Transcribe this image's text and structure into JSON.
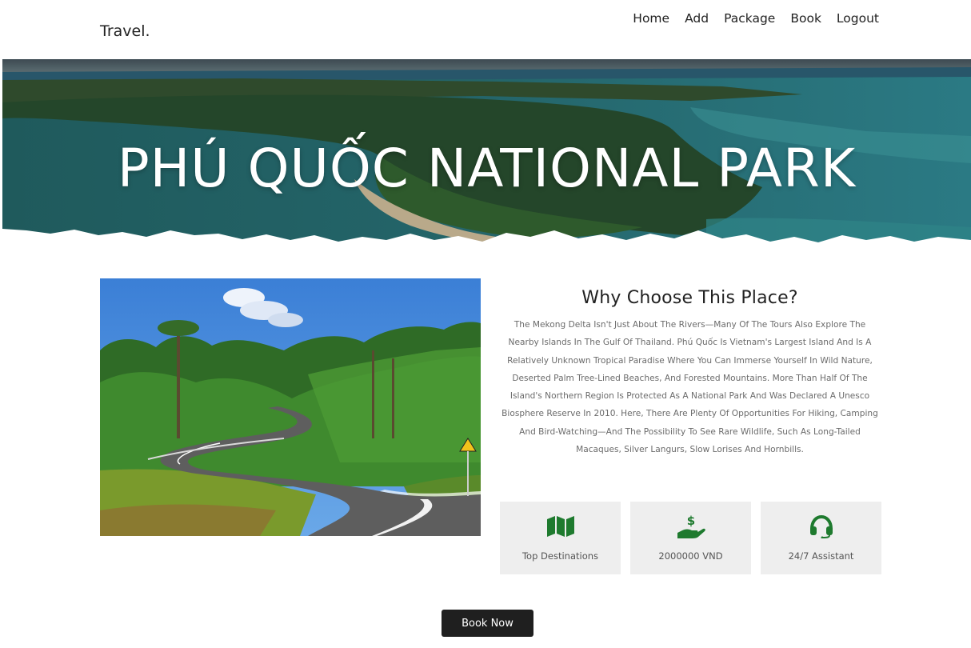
{
  "header": {
    "logo": "Travel.",
    "nav": [
      "Home",
      "Add",
      "Package",
      "Book",
      "Logout"
    ]
  },
  "hero": {
    "title": "PHÚ QUỐC NATIONAL PARK"
  },
  "main": {
    "heading": "Why Choose This Place?",
    "description": "The Mekong Delta Isn't Just About The Rivers—Many Of The Tours Also Explore The Nearby Islands In The Gulf Of Thailand. Phú Quốc Is Vietnam's Largest Island And Is A Relatively Unknown Tropical Paradise Where You Can Immerse Yourself In Wild Nature, Deserted Palm Tree-Lined Beaches, And Forested Mountains. More Than Half Of The Island's Northern Region Is Protected As A National Park And Was Declared A Unesco Biosphere Reserve In 2010. Here, There Are Plenty Of Opportunities For Hiking, Camping And Bird-Watching—And The Possibility To See Rare Wildlife, Such As Long-Tailed Macaques, Silver Langurs, Slow Lorises And Hornbills.",
    "features": [
      {
        "icon": "map-icon",
        "label": "Top Destinations"
      },
      {
        "icon": "dollar-hand-icon",
        "label": "2000000 VND"
      },
      {
        "icon": "headset-icon",
        "label": "24/7 Assistant"
      }
    ]
  },
  "book_button": "Book Now",
  "colors": {
    "accent_green": "#1e7a2e",
    "button_dark": "#1f1f1f",
    "feature_bg": "#eeeeee"
  }
}
